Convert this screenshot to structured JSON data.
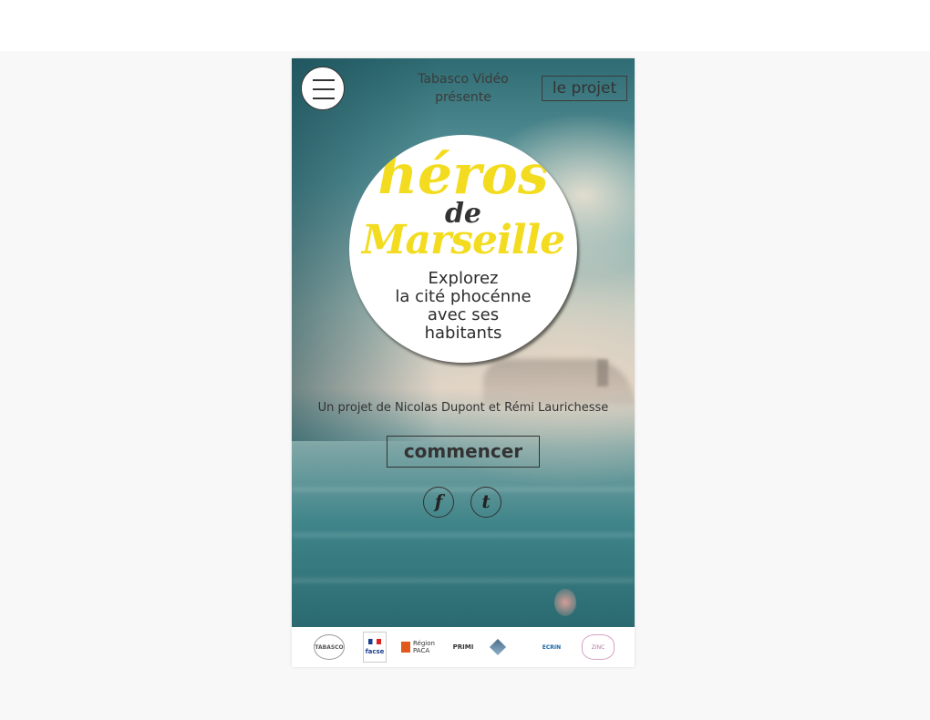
{
  "header": {
    "menu_icon": "hamburger-menu-icon",
    "presenter_line1": "Tabasco Vidéo",
    "presenter_line2": "présente",
    "project_link": "le projet"
  },
  "logo": {
    "word1": "héros",
    "word2": "de",
    "word3": "Marseille",
    "colors": {
      "yellow": "#f3dc20",
      "dark": "#333333"
    }
  },
  "tagline": {
    "line1": "Explorez",
    "line2": "la cité phocénne",
    "line3": "avec ses",
    "line4": "habitants"
  },
  "credit": "Un projet de Nicolas Dupont et Rémi Laurichesse",
  "start_button": "commencer",
  "social": [
    {
      "icon": "facebook-icon",
      "glyph": "f"
    },
    {
      "icon": "twitter-icon",
      "glyph": "t"
    }
  ],
  "partners": {
    "tabasco": "TABASCO",
    "facse": "facse",
    "paca_line1": "Région",
    "paca_line2": "PACA",
    "primi": "PRIMI",
    "ecrin": "ECRIN",
    "zinc": "ZINC"
  }
}
